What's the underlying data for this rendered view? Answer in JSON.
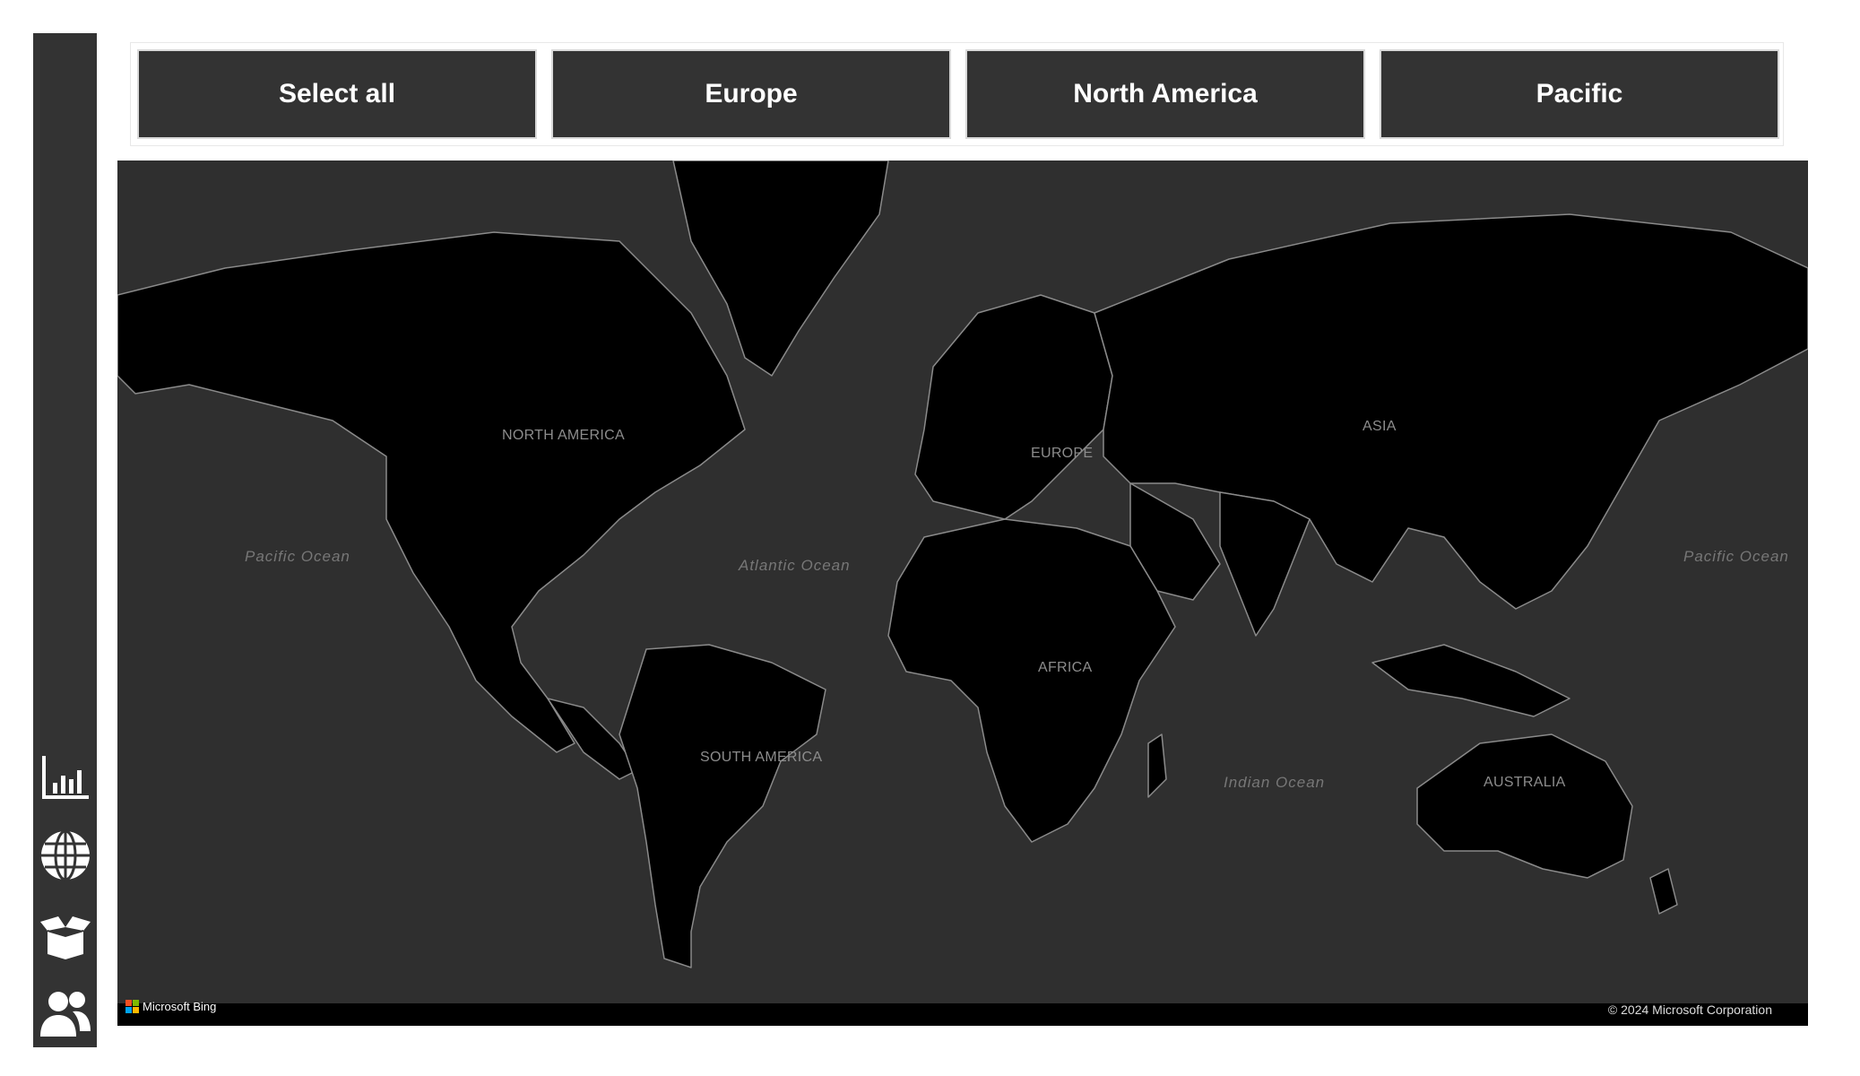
{
  "filters": {
    "buttons": [
      {
        "label": "Select all"
      },
      {
        "label": "Europe"
      },
      {
        "label": "North America"
      },
      {
        "label": "Pacific"
      }
    ]
  },
  "sidebar": {
    "items": [
      {
        "icon": "bar-chart-icon"
      },
      {
        "icon": "globe-icon"
      },
      {
        "icon": "open-box-icon"
      },
      {
        "icon": "users-icon"
      }
    ]
  },
  "map": {
    "continents": {
      "north_america": "NORTH AMERICA",
      "europe": "EUROPE",
      "asia": "ASIA",
      "africa": "AFRICA",
      "south_america": "SOUTH AMERICA",
      "australia": "AUSTRALIA"
    },
    "oceans": {
      "pacific_west": "Pacific Ocean",
      "atlantic": "Atlantic Ocean",
      "indian": "Indian Ocean",
      "pacific_east": "Pacific Ocean"
    },
    "provider": "Microsoft Bing",
    "copyright": "© 2024 Microsoft Corporation",
    "colors": {
      "water": "#2f2f2f",
      "land": "#000000",
      "borders": "#9a9a9a"
    }
  },
  "colors": {
    "sidebar": "#333333",
    "button_bg": "#333333",
    "button_text": "#ffffff"
  }
}
